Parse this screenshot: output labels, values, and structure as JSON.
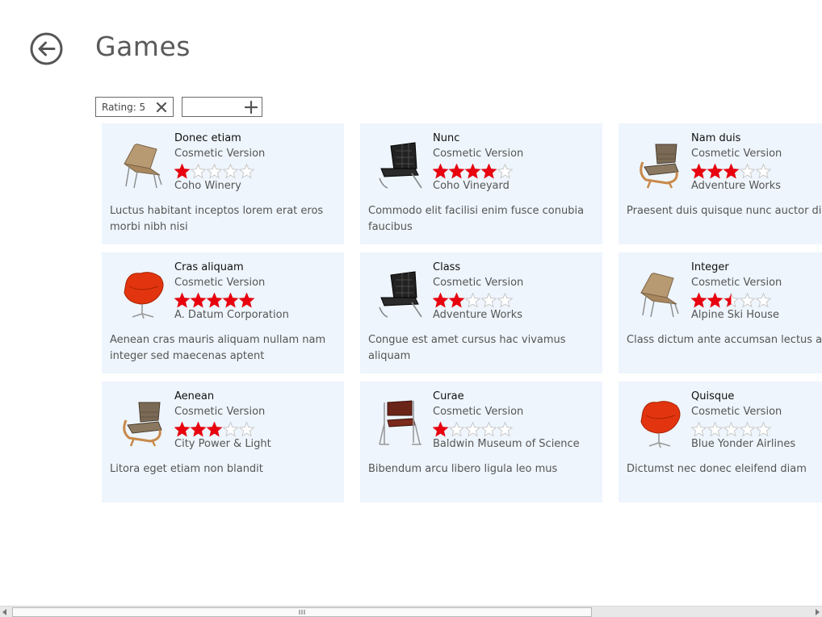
{
  "page": {
    "title": "Games"
  },
  "filters": {
    "rating_chip_label": "Rating: 5"
  },
  "colors": {
    "star_filled": "#e8000f",
    "star_empty": "#c8c8c8",
    "card_bg": "#eef5fc"
  },
  "items": [
    {
      "title": "Donec etiam",
      "subtitle": "Cosmetic Version",
      "rating": 1,
      "maker": "Coho Winery",
      "description": "Luctus habitant inceptos lorem erat eros morbi nibh nisi",
      "image": "tan-lounge-chair"
    },
    {
      "title": "Nunc",
      "subtitle": "Cosmetic Version",
      "rating": 4,
      "maker": "Coho Vineyard",
      "description": "Commodo elit facilisi enim fusce conubia faucibus",
      "image": "black-leather-chair"
    },
    {
      "title": "Nam duis",
      "subtitle": "Cosmetic Version",
      "rating": 3,
      "maker": "Adventure Works",
      "description": "Praesent duis quisque nunc auctor dis",
      "image": "bentwood-armchair"
    },
    {
      "title": "Cras aliquam",
      "subtitle": "Cosmetic Version",
      "rating": 5,
      "maker": "A. Datum Corporation",
      "description": "Aenean cras mauris aliquam nullam nam integer sed maecenas aptent",
      "image": "red-swan-chair"
    },
    {
      "title": "Class",
      "subtitle": "Cosmetic Version",
      "rating": 2,
      "maker": "Adventure Works",
      "description": "Congue est amet cursus hac vivamus aliquam",
      "image": "black-leather-chair"
    },
    {
      "title": "Integer",
      "subtitle": "Cosmetic Version",
      "rating": 2.5,
      "maker": "Alpine Ski House",
      "description": "Class dictum ante accumsan lectus aliquet d",
      "image": "tan-lounge-chair"
    },
    {
      "title": "Aenean",
      "subtitle": "Cosmetic Version",
      "rating": 3,
      "maker": "City Power & Light",
      "description": "Litora eget etiam non blandit",
      "image": "bentwood-armchair"
    },
    {
      "title": "Curae",
      "subtitle": "Cosmetic Version",
      "rating": 1,
      "maker": "Baldwin Museum of Science",
      "description": "Bibendum arcu libero ligula leo mus",
      "image": "brown-sling-chair"
    },
    {
      "title": "Quisque",
      "subtitle": "Cosmetic Version",
      "rating": 0,
      "maker": "Blue Yonder Airlines",
      "description": "Dictumst nec donec eleifend diam",
      "image": "red-swan-chair"
    }
  ]
}
